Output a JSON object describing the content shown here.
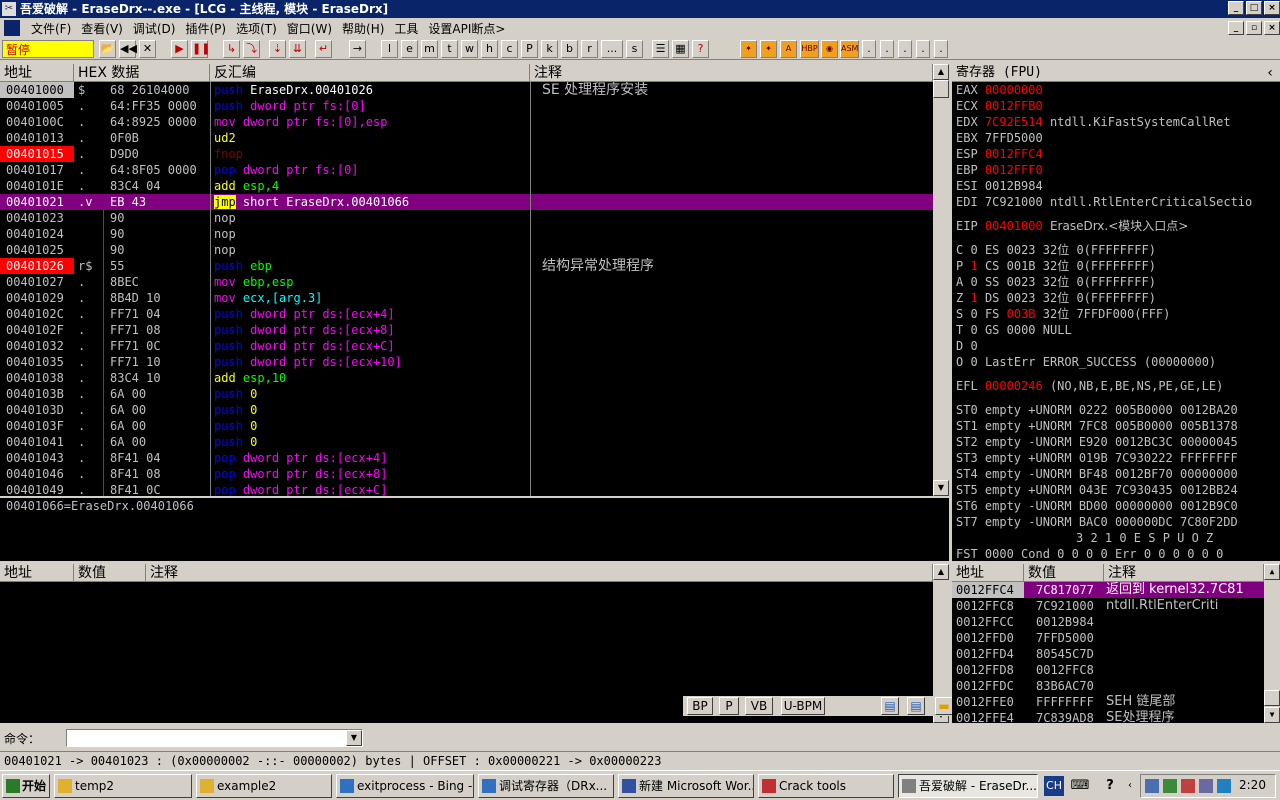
{
  "title_bar": {
    "title": "吾爱破解 - EraseDrx--.exe - [LCG - 主线程, 模块 - EraseDrx]"
  },
  "menu": {
    "items": [
      "文件(F)",
      "查看(V)",
      "调试(D)",
      "插件(P)",
      "选项(T)",
      "窗口(W)",
      "帮助(H)",
      "工具",
      "设置API断点>"
    ]
  },
  "toolbar": {
    "status": "暂停",
    "letters": [
      "l",
      "e",
      "m",
      "t",
      "w",
      "h",
      "c",
      "P",
      "k",
      "b",
      "r",
      "...",
      "s"
    ],
    "plugin_labels": [
      "HBP",
      "ASM"
    ]
  },
  "disasm": {
    "headers": [
      "地址",
      "HEX 数据",
      "反汇编",
      "注释"
    ],
    "rows": [
      {
        "addr": "00401000",
        "mark": "$",
        "hex": "68 26104000",
        "op": "push",
        "args": "EraseDrx.00401026",
        "cmt": "SE 处理程序安装",
        "state": "sel",
        "cls": "push"
      },
      {
        "addr": "00401005",
        "mark": ".",
        "hex": "64:FF35 0000",
        "op": "push",
        "args": "dword ptr fs:[0]",
        "cmt": "",
        "state": "",
        "cls": "push"
      },
      {
        "addr": "0040100C",
        "mark": ".",
        "hex": "64:8925 0000",
        "op": "mov",
        "args": "dword ptr fs:[0],esp",
        "cmt": "",
        "state": "",
        "cls": "mov"
      },
      {
        "addr": "00401013",
        "mark": ".",
        "hex": "0F0B",
        "op": "ud2",
        "args": "",
        "cmt": "",
        "state": "",
        "cls": "ud"
      },
      {
        "addr": "00401015",
        "mark": ".",
        "hex": "D9D0",
        "op": "fnop",
        "args": "",
        "cmt": "",
        "state": "red",
        "cls": "bad"
      },
      {
        "addr": "00401017",
        "mark": ".",
        "hex": "64:8F05 0000",
        "op": "pop",
        "args": "dword ptr fs:[0]",
        "cmt": "",
        "state": "",
        "cls": "pop"
      },
      {
        "addr": "0040101E",
        "mark": ".",
        "hex": "83C4 04",
        "op": "add",
        "args": "esp,4",
        "cmt": "",
        "state": "",
        "cls": "add"
      },
      {
        "addr": "00401021",
        "mark": ".v",
        "hex": "EB 43",
        "op": "jmp",
        "args": "short EraseDrx.00401066",
        "cmt": "",
        "state": "hl",
        "cls": "jmp"
      },
      {
        "addr": "00401023",
        "mark": "",
        "hex": "90",
        "op": "nop",
        "args": "",
        "cmt": "",
        "state": "",
        "cls": "nop"
      },
      {
        "addr": "00401024",
        "mark": "",
        "hex": "90",
        "op": "nop",
        "args": "",
        "cmt": "",
        "state": "",
        "cls": "nop"
      },
      {
        "addr": "00401025",
        "mark": "",
        "hex": "90",
        "op": "nop",
        "args": "",
        "cmt": "",
        "state": "",
        "cls": "nop"
      },
      {
        "addr": "00401026",
        "mark": "r$",
        "hex": "55",
        "op": "push",
        "args": "ebp",
        "cmt": "结构异常处理程序",
        "state": "red",
        "cls": "push"
      },
      {
        "addr": "00401027",
        "mark": ".",
        "hex": "8BEC",
        "op": "mov",
        "args": "ebp,esp",
        "cmt": "",
        "state": "",
        "cls": "mov"
      },
      {
        "addr": "00401029",
        "mark": ".",
        "hex": "8B4D 10",
        "op": "mov",
        "args": "ecx,[arg.3]",
        "cmt": "",
        "state": "",
        "cls": "mov"
      },
      {
        "addr": "0040102C",
        "mark": ".",
        "hex": "FF71 04",
        "op": "push",
        "args": "dword ptr ds:[ecx+4]",
        "cmt": "",
        "state": "",
        "cls": "push"
      },
      {
        "addr": "0040102F",
        "mark": ".",
        "hex": "FF71 08",
        "op": "push",
        "args": "dword ptr ds:[ecx+8]",
        "cmt": "",
        "state": "",
        "cls": "push"
      },
      {
        "addr": "00401032",
        "mark": ".",
        "hex": "FF71 0C",
        "op": "push",
        "args": "dword ptr ds:[ecx+C]",
        "cmt": "",
        "state": "",
        "cls": "push"
      },
      {
        "addr": "00401035",
        "mark": ".",
        "hex": "FF71 10",
        "op": "push",
        "args": "dword ptr ds:[ecx+10]",
        "cmt": "",
        "state": "",
        "cls": "push"
      },
      {
        "addr": "00401038",
        "mark": ".",
        "hex": "83C4 10",
        "op": "add",
        "args": "esp,10",
        "cmt": "",
        "state": "",
        "cls": "add"
      },
      {
        "addr": "0040103B",
        "mark": ".",
        "hex": "6A 00",
        "op": "push",
        "args": "0",
        "cmt": "",
        "state": "",
        "cls": "push"
      },
      {
        "addr": "0040103D",
        "mark": ".",
        "hex": "6A 00",
        "op": "push",
        "args": "0",
        "cmt": "",
        "state": "",
        "cls": "push"
      },
      {
        "addr": "0040103F",
        "mark": ".",
        "hex": "6A 00",
        "op": "push",
        "args": "0",
        "cmt": "",
        "state": "",
        "cls": "push"
      },
      {
        "addr": "00401041",
        "mark": ".",
        "hex": "6A 00",
        "op": "push",
        "args": "0",
        "cmt": "",
        "state": "",
        "cls": "push"
      },
      {
        "addr": "00401043",
        "mark": ".",
        "hex": "8F41 04",
        "op": "pop",
        "args": "dword ptr ds:[ecx+4]",
        "cmt": "",
        "state": "",
        "cls": "pop"
      },
      {
        "addr": "00401046",
        "mark": ".",
        "hex": "8F41 08",
        "op": "pop",
        "args": "dword ptr ds:[ecx+8]",
        "cmt": "",
        "state": "",
        "cls": "pop"
      },
      {
        "addr": "00401049",
        "mark": ".",
        "hex": "8F41 0C",
        "op": "pop",
        "args": "dword ptr ds:[ecx+C]",
        "cmt": "",
        "state": "",
        "cls": "pop"
      }
    ],
    "info_line": "00401066=EraseDrx.00401066"
  },
  "registers": {
    "title": "寄存器 (FPU)",
    "lines": [
      {
        "name": "EAX",
        "val": "00000000",
        "extra": "",
        "red": true
      },
      {
        "name": "ECX",
        "val": "0012FFB0",
        "extra": "",
        "red": true
      },
      {
        "name": "EDX",
        "val": "7C92E514",
        "extra": "ntdll.KiFastSystemCallRet",
        "red": true
      },
      {
        "name": "EBX",
        "val": "7FFD5000",
        "extra": "",
        "red": false
      },
      {
        "name": "ESP",
        "val": "0012FFC4",
        "extra": "",
        "red": true
      },
      {
        "name": "EBP",
        "val": "0012FFF0",
        "extra": "",
        "red": true
      },
      {
        "name": "ESI",
        "val": "0012B984",
        "extra": "",
        "red": false
      },
      {
        "name": "EDI",
        "val": "7C921000",
        "extra": "ntdll.RtlEnterCriticalSectio",
        "red": false
      }
    ],
    "eip": {
      "name": "EIP",
      "val": "00401000",
      "extra": "EraseDrx.<模块入口点>"
    },
    "flags": [
      {
        "f": "C",
        "v": "0",
        "seg": "ES",
        "sel": "0023",
        "bits": "32位",
        "rest": "0(FFFFFFFF)",
        "vred": false,
        "sred": false
      },
      {
        "f": "P",
        "v": "1",
        "seg": "CS",
        "sel": "001B",
        "bits": "32位",
        "rest": "0(FFFFFFFF)",
        "vred": true,
        "sred": false
      },
      {
        "f": "A",
        "v": "0",
        "seg": "SS",
        "sel": "0023",
        "bits": "32位",
        "rest": "0(FFFFFFFF)",
        "vred": false,
        "sred": false
      },
      {
        "f": "Z",
        "v": "1",
        "seg": "DS",
        "sel": "0023",
        "bits": "32位",
        "rest": "0(FFFFFFFF)",
        "vred": true,
        "sred": false
      },
      {
        "f": "S",
        "v": "0",
        "seg": "FS",
        "sel": "003B",
        "bits": "32位",
        "rest": "7FFDF000(FFF)",
        "vred": false,
        "sred": true
      },
      {
        "f": "T",
        "v": "0",
        "seg": "GS",
        "sel": "0000",
        "bits": "NULL",
        "rest": "",
        "vred": false,
        "sred": false
      },
      {
        "f": "D",
        "v": "0",
        "seg": "",
        "sel": "",
        "bits": "",
        "rest": "",
        "vred": false,
        "sred": false
      },
      {
        "f": "O",
        "v": "0",
        "seg": "LastErr",
        "sel": "ERROR_SUCCESS",
        "bits": "(00000000)",
        "rest": "",
        "vred": false,
        "sred": false
      }
    ],
    "efl": {
      "name": "EFL",
      "val": "00000246",
      "extra": "(NO,NB,E,BE,NS,PE,GE,LE)"
    },
    "fpu": [
      "ST0 empty +UNORM 0222 005B0000 0012BA20",
      "ST1 empty +UNORM 7FC8 005B0000 005B1378",
      "ST2 empty -UNORM E920 0012BC3C 00000045",
      "ST3 empty +UNORM 019B 7C930222 FFFFFFFF",
      "ST4 empty -UNORM BF48 0012BF70 00000000",
      "ST5 empty +UNORM 043E 7C930435 0012BB24",
      "ST6 empty -UNORM BD00 00000000 0012B9C0",
      "ST7 empty -UNORM BAC0 000000DC 7C80F2DD"
    ],
    "fpu_hdr": "3 2 1 0      E S P U O Z",
    "fst": "FST 0000  Cond 0 0 0 0  Err 0 0 0 0 0 0"
  },
  "dump": {
    "headers": [
      "地址",
      "数值",
      "注释"
    ]
  },
  "stack": {
    "headers": [
      "地址",
      "数值",
      "注释"
    ],
    "rows": [
      {
        "addr": "0012FFC4",
        "val": "7C817077",
        "cmt": "返回到 kernel32.7C81",
        "sel": true
      },
      {
        "addr": "0012FFC8",
        "val": "7C921000",
        "cmt": "ntdll.RtlEnterCriti",
        "sel": false
      },
      {
        "addr": "0012FFCC",
        "val": "0012B984",
        "cmt": "",
        "sel": false
      },
      {
        "addr": "0012FFD0",
        "val": "7FFD5000",
        "cmt": "",
        "sel": false
      },
      {
        "addr": "0012FFD4",
        "val": "80545C7D",
        "cmt": "",
        "sel": false
      },
      {
        "addr": "0012FFD8",
        "val": "0012FFC8",
        "cmt": "",
        "sel": false
      },
      {
        "addr": "0012FFDC",
        "val": "83B6AC70",
        "cmt": "",
        "sel": false
      },
      {
        "addr": "0012FFE0",
        "val": "FFFFFFFF",
        "cmt": "SEH 链尾部",
        "sel": false
      },
      {
        "addr": "0012FFE4",
        "val": "7C839AD8",
        "cmt": "SE处理程序",
        "sel": false
      }
    ]
  },
  "minibar": {
    "buttons": [
      "BP",
      "P",
      "VB",
      "U-BPM"
    ]
  },
  "command": {
    "label": "命令：",
    "value": ""
  },
  "status": {
    "text": "00401021 -> 00401023 : (0x00000002  -::-  00000002) bytes   |   OFFSET : 0x00000221 -> 0x00000223"
  },
  "taskbar": {
    "start": "开始",
    "tasks": [
      "temp2",
      "example2",
      "exitprocess - Bing - ...",
      "调试寄存器（DRx...",
      "新建 Microsoft Wor...",
      "Crack tools",
      "吾爱破解 - EraseDr..."
    ],
    "lang": "CH",
    "clock": "2:20"
  }
}
